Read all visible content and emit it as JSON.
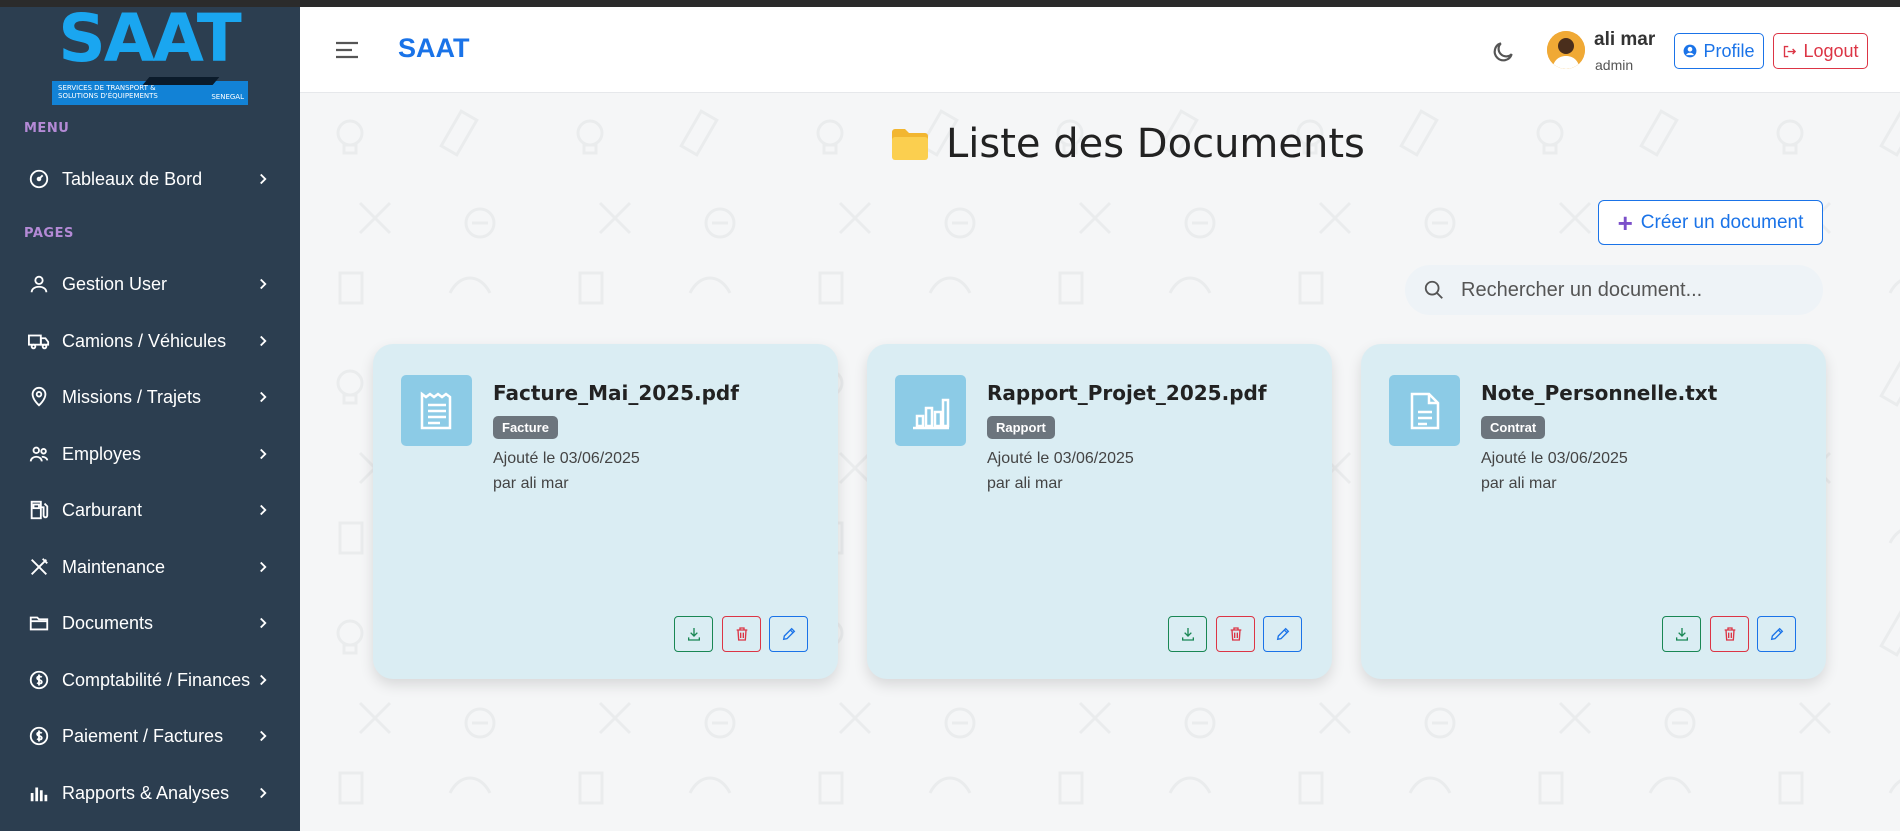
{
  "logo": {
    "text": "SAAT",
    "subtitle": "SERVICES DE TRANSPORT & SOLUTIONS D'ÉQUIPEMENTS",
    "country": "SENEGAL"
  },
  "sidebar": {
    "menu_title": "MENU",
    "pages_title": "PAGES",
    "menu_items": [
      {
        "label": "Tableaux de Bord",
        "icon": "gauge-icon"
      }
    ],
    "items": [
      {
        "label": "Gestion User",
        "icon": "user-icon"
      },
      {
        "label": "Camions / Véhicules",
        "icon": "truck-icon"
      },
      {
        "label": "Missions / Trajets",
        "icon": "map-pin-icon"
      },
      {
        "label": "Employes",
        "icon": "people-icon"
      },
      {
        "label": "Carburant",
        "icon": "fuel-icon"
      },
      {
        "label": "Maintenance",
        "icon": "tools-icon"
      },
      {
        "label": "Documents",
        "icon": "folder-icon"
      },
      {
        "label": "Comptabilité / Finances",
        "icon": "dollar-circle-icon"
      },
      {
        "label": "Paiement / Factures",
        "icon": "dollar-circle-icon"
      },
      {
        "label": "Rapports & Analyses",
        "icon": "bar-chart-icon"
      }
    ]
  },
  "header": {
    "brand": "SAAT",
    "user_name": "ali mar",
    "user_role": "admin",
    "profile_label": "Profile",
    "logout_label": "Logout"
  },
  "main": {
    "title": "Liste des Documents",
    "create_label": "Créer un document",
    "search_placeholder": "Rechercher un document..."
  },
  "documents": [
    {
      "name": "Facture_Mai_2025.pdf",
      "type": "Facture",
      "date": "Ajouté le 03/06/2025",
      "author": "par ali mar",
      "icon": "receipt-icon"
    },
    {
      "name": "Rapport_Projet_2025.pdf",
      "type": "Rapport",
      "date": "Ajouté le 03/06/2025",
      "author": "par ali mar",
      "icon": "bar-chart-icon"
    },
    {
      "name": "Note_Personnelle.txt",
      "type": "Contrat",
      "date": "Ajouté le 03/06/2025",
      "author": "par ali mar",
      "icon": "document-icon"
    }
  ],
  "colors": {
    "sidebar_bg": "#2c3e50",
    "accent": "#1a73e8",
    "danger": "#dc3545",
    "success": "#198754",
    "card_bg": "#daedf3",
    "icon_bg": "#8ccbe6",
    "badge_bg": "#6c757d"
  }
}
